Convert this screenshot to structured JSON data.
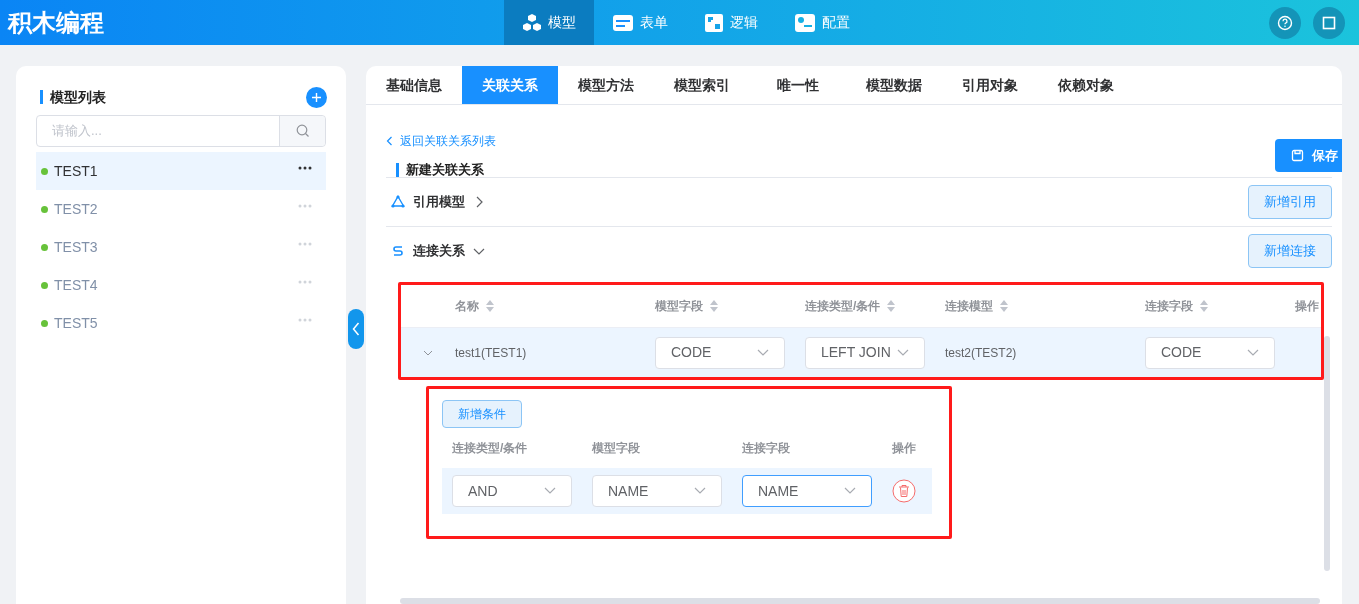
{
  "app_title": "积木编程",
  "nav": [
    {
      "label": "模型",
      "selected": true
    },
    {
      "label": "表单",
      "selected": false
    },
    {
      "label": "逻辑",
      "selected": false
    },
    {
      "label": "配置",
      "selected": false
    }
  ],
  "sidebar": {
    "title": "模型列表",
    "search": {
      "placeholder": "请输入..."
    },
    "items": [
      {
        "label": "TEST1",
        "selected": true,
        "color": "#67c23a"
      },
      {
        "label": "TEST2",
        "selected": false,
        "color": "#67c23a"
      },
      {
        "label": "TEST3",
        "selected": false,
        "color": "#67c23a"
      },
      {
        "label": "TEST4",
        "selected": false,
        "color": "#67c23a"
      },
      {
        "label": "TEST5",
        "selected": false,
        "color": "#67c23a"
      }
    ]
  },
  "tabs": [
    {
      "label": "基础信息",
      "selected": false
    },
    {
      "label": "关联关系",
      "selected": true
    },
    {
      "label": "模型方法",
      "selected": false
    },
    {
      "label": "模型索引",
      "selected": false
    },
    {
      "label": "唯一性",
      "selected": false
    },
    {
      "label": "模型数据",
      "selected": false
    },
    {
      "label": "引用对象",
      "selected": false
    },
    {
      "label": "依赖对象",
      "selected": false
    }
  ],
  "back_link": "返回关联关系列表",
  "form_title": "新建关联关系",
  "save_button": "保存",
  "sections": [
    {
      "label": "引用模型",
      "expanded": false,
      "button": "新增引用"
    },
    {
      "label": "连接关系",
      "expanded": true,
      "button": "新增连接"
    }
  ],
  "join_table": {
    "columns": [
      {
        "label": "名称",
        "sortable": true
      },
      {
        "label": "模型字段",
        "sortable": true
      },
      {
        "label": "连接类型/条件",
        "sortable": true
      },
      {
        "label": "连接模型",
        "sortable": true
      },
      {
        "label": "连接字段",
        "sortable": true
      },
      {
        "label": "操作",
        "sortable": false
      }
    ],
    "rows": [
      {
        "expanded": true,
        "name": "test1(TEST1)",
        "model_field": "CODE",
        "join_type": "LEFT JOIN",
        "join_model": "test2(TEST2)",
        "join_field": "CODE"
      }
    ]
  },
  "conditions": {
    "add_button": "新增条件",
    "columns": [
      "连接类型/条件",
      "模型字段",
      "连接字段",
      "操作"
    ],
    "rows": [
      {
        "condition": "AND",
        "model_field": "NAME",
        "join_field": "NAME",
        "join_field_focused": true
      }
    ]
  }
}
